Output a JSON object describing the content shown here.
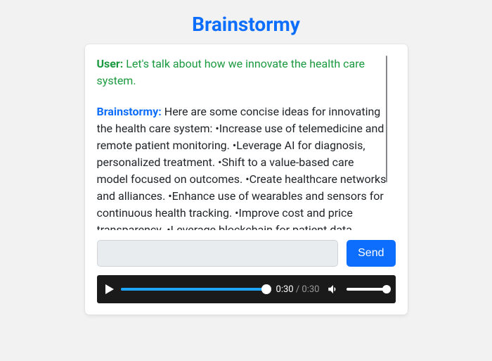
{
  "title": "Brainstormy",
  "labels": {
    "user": "User:",
    "bot": "Brainstormy:"
  },
  "messages": {
    "user_text": "Let's talk about how we innovate the health care system.",
    "bot_text": "Here are some concise ideas for innovating the health care system: •Increase use of telemedicine and remote patient monitoring. •Leverage AI for diagnosis, personalized treatment. •Shift to a value-based care model focused on outcomes. •Create healthcare networks and alliances. •Enhance use of wearables and sensors for continuous health tracking. •Improve cost and price transparency. •Leverage blockchain for patient data security and interoperability. •Expand preventive care and wellness programs."
  },
  "input": {
    "value": "",
    "placeholder": ""
  },
  "buttons": {
    "send": "Send"
  },
  "player": {
    "current": "0:30",
    "duration": "0:30",
    "separator": " / "
  }
}
